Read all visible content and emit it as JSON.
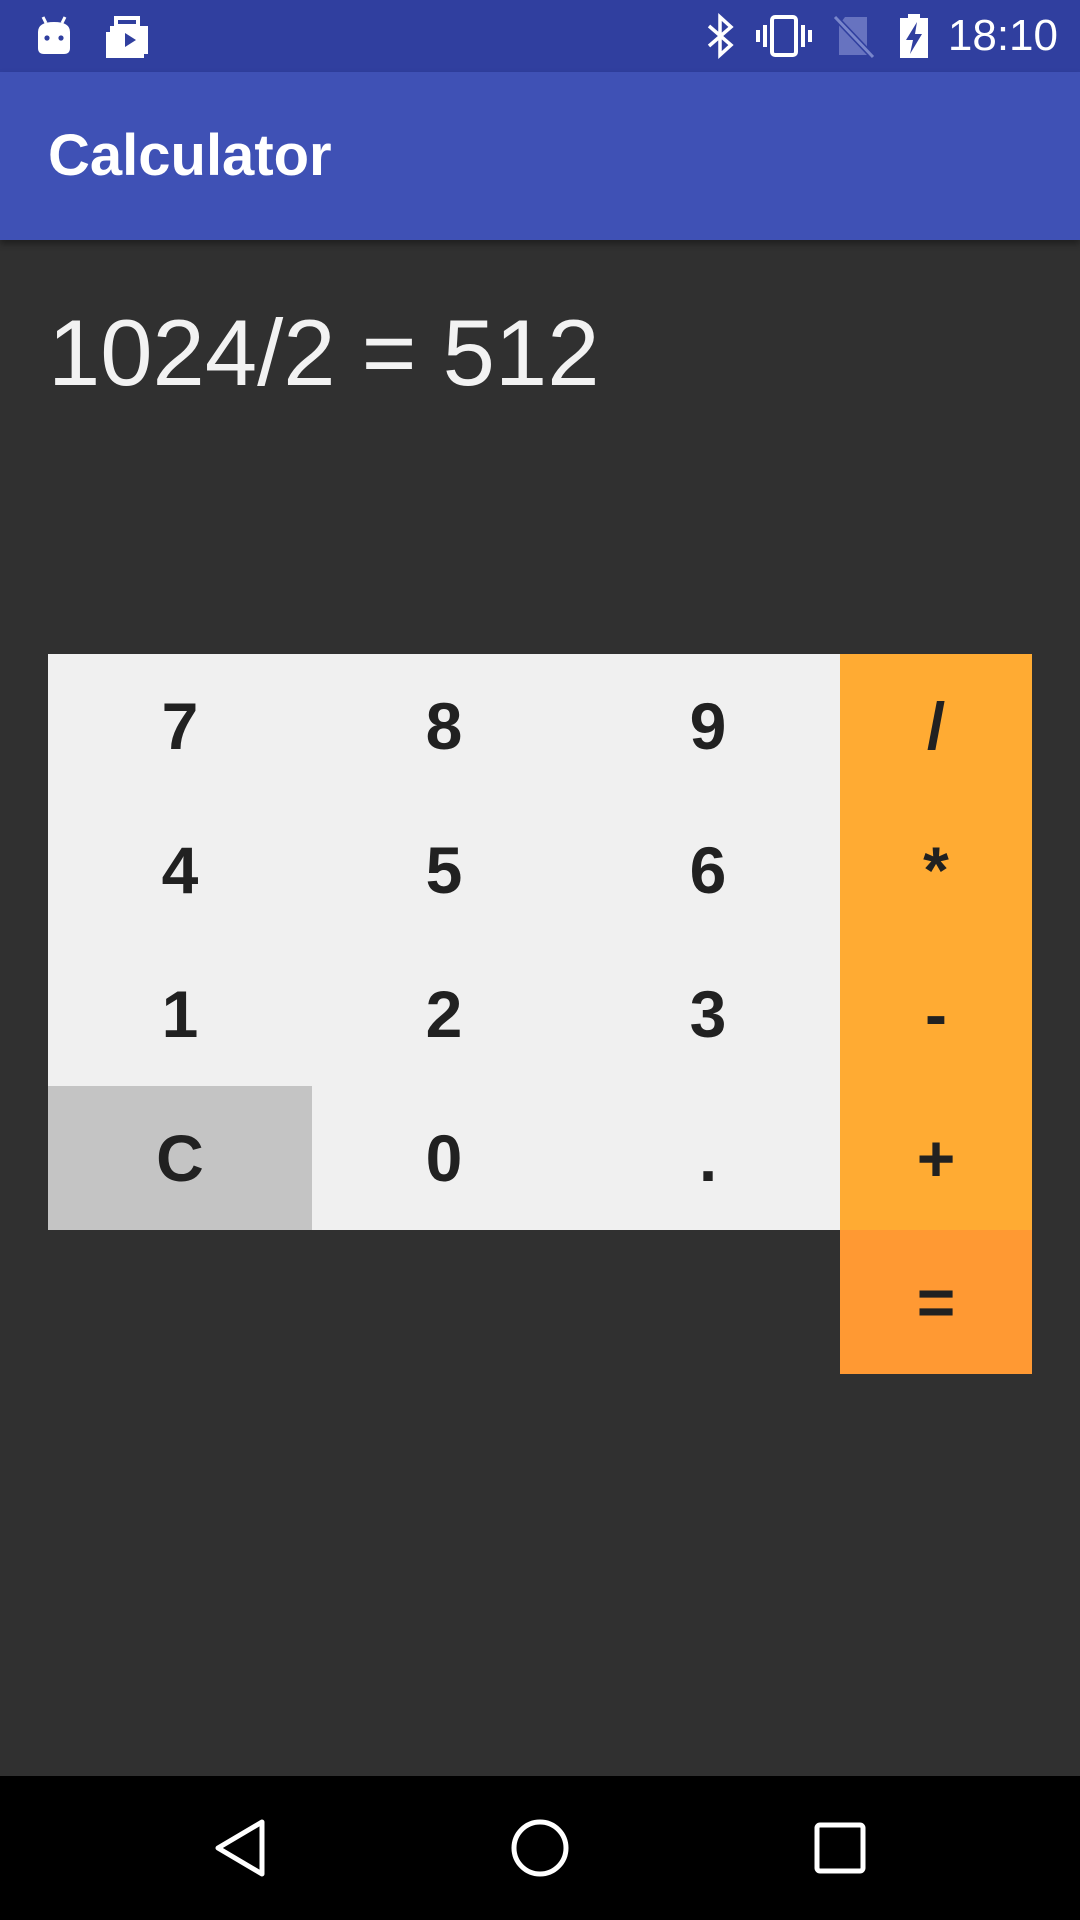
{
  "status_bar": {
    "time": "18:10",
    "icons": [
      "android-notification-icon",
      "briefcase-play-icon",
      "bluetooth-icon",
      "vibrate-icon",
      "no-sim-icon",
      "battery-charging-icon"
    ]
  },
  "app_bar": {
    "title": "Calculator"
  },
  "display": {
    "expression": "1024/2 = 512"
  },
  "keypad": {
    "row1": [
      "7",
      "8",
      "9",
      "/"
    ],
    "row2": [
      "4",
      "5",
      "6",
      "*"
    ],
    "row3": [
      "1",
      "2",
      "3",
      "-"
    ],
    "row4": [
      "C",
      "0",
      ".",
      "+"
    ],
    "equals": "="
  },
  "colors": {
    "status_bar": "#303F9F",
    "app_bar": "#3F51B5",
    "background": "#303030",
    "number_key": "#F0F0F0",
    "clear_key": "#C4C4C4",
    "operator_key": "#FFAB33",
    "equals_key": "#FF9933"
  },
  "nav_bar": {
    "buttons": [
      "back-icon",
      "home-icon",
      "recents-icon"
    ]
  }
}
